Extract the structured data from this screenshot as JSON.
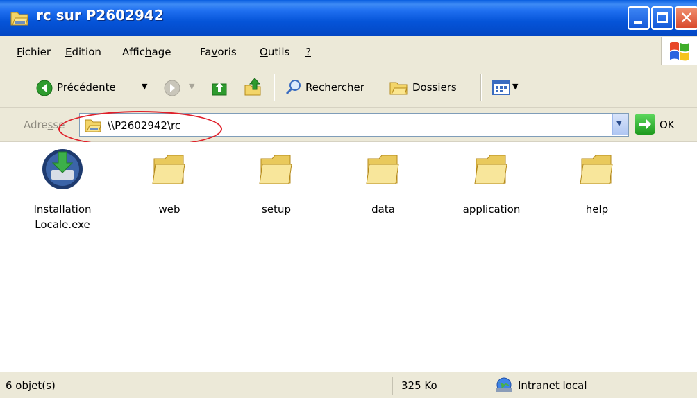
{
  "window": {
    "title": "rc sur P2602942"
  },
  "menu": [
    {
      "key": "fichier",
      "first": "F",
      "rest": "ichier"
    },
    {
      "key": "edition",
      "first": "E",
      "rest": "dition"
    },
    {
      "key": "affichage",
      "pre": "Affic",
      "u": "h",
      "post": "age"
    },
    {
      "key": "favoris",
      "pre": "Fa",
      "u": "v",
      "post": "oris"
    },
    {
      "key": "outils",
      "first": "O",
      "rest": "utils"
    },
    {
      "key": "help",
      "first": "?",
      "rest": ""
    }
  ],
  "toolbar": {
    "back_label": "Précédente",
    "search_label": "Rechercher",
    "folders_label": "Dossiers"
  },
  "address": {
    "label_pre": "Adre",
    "label_u": "s",
    "label_post": "se",
    "path": "\\\\P2602942\\rc",
    "go_label": "OK"
  },
  "items": [
    {
      "name": "installer",
      "line1": "Installation",
      "line2": "Locale.exe",
      "icon": "installer-icon"
    },
    {
      "name": "folder-web",
      "line1": "web",
      "line2": "",
      "icon": "folder-icon"
    },
    {
      "name": "folder-setup",
      "line1": "setup",
      "line2": "",
      "icon": "folder-icon"
    },
    {
      "name": "folder-data",
      "line1": "data",
      "line2": "",
      "icon": "folder-icon"
    },
    {
      "name": "folder-application",
      "line1": "application",
      "line2": "",
      "icon": "folder-icon"
    },
    {
      "name": "folder-help",
      "line1": "help",
      "line2": "",
      "icon": "folder-icon"
    }
  ],
  "status": {
    "objects": "6 objet(s)",
    "size": "325 Ko",
    "zone": "Intranet local"
  },
  "colors": {
    "titlebar": "#0554d8",
    "annotation": "#e0202a",
    "folder": "#f6e79a"
  }
}
